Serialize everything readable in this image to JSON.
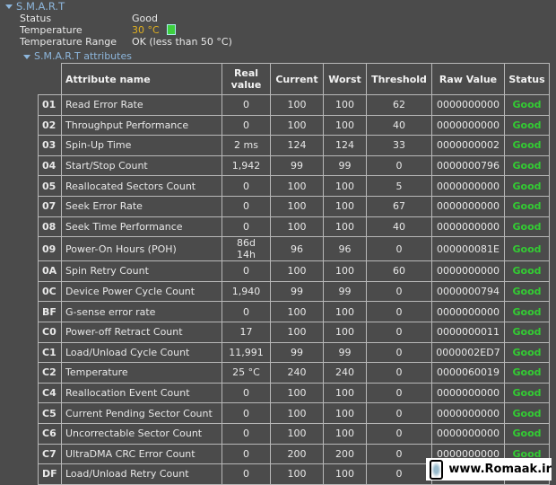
{
  "section": "S.M.A.R.T",
  "info": [
    {
      "label": "Status",
      "value": "Good"
    },
    {
      "label": "Temperature",
      "value": "30 °C"
    },
    {
      "label": "Temperature Range",
      "value": "OK (less than 50 °C)"
    }
  ],
  "subsection": "S.M.A.R.T attributes",
  "colors": {
    "temperature": "#e0b020",
    "good": "#33cc33",
    "section": "#8db6dc"
  },
  "headers": [
    "Attribute name",
    "Real value",
    "Current",
    "Worst",
    "Threshold",
    "Raw Value",
    "Status"
  ],
  "rows": [
    [
      "01",
      "Read Error Rate",
      "0",
      "100",
      "100",
      "62",
      "0000000000",
      "Good"
    ],
    [
      "02",
      "Throughput Performance",
      "0",
      "100",
      "100",
      "40",
      "0000000000",
      "Good"
    ],
    [
      "03",
      "Spin-Up Time",
      "2 ms",
      "124",
      "124",
      "33",
      "0000000002",
      "Good"
    ],
    [
      "04",
      "Start/Stop Count",
      "1,942",
      "99",
      "99",
      "0",
      "0000000796",
      "Good"
    ],
    [
      "05",
      "Reallocated Sectors Count",
      "0",
      "100",
      "100",
      "5",
      "0000000000",
      "Good"
    ],
    [
      "07",
      "Seek Error Rate",
      "0",
      "100",
      "100",
      "67",
      "0000000000",
      "Good"
    ],
    [
      "08",
      "Seek Time Performance",
      "0",
      "100",
      "100",
      "40",
      "0000000000",
      "Good"
    ],
    [
      "09",
      "Power-On Hours (POH)",
      "86d 14h",
      "96",
      "96",
      "0",
      "000000081E",
      "Good"
    ],
    [
      "0A",
      "Spin Retry Count",
      "0",
      "100",
      "100",
      "60",
      "0000000000",
      "Good"
    ],
    [
      "0C",
      "Device Power Cycle Count",
      "1,940",
      "99",
      "99",
      "0",
      "0000000794",
      "Good"
    ],
    [
      "BF",
      "G-sense error rate",
      "0",
      "100",
      "100",
      "0",
      "0000000000",
      "Good"
    ],
    [
      "C0",
      "Power-off Retract Count",
      "17",
      "100",
      "100",
      "0",
      "0000000011",
      "Good"
    ],
    [
      "C1",
      "Load/Unload Cycle Count",
      "11,991",
      "99",
      "99",
      "0",
      "0000002ED7",
      "Good"
    ],
    [
      "C2",
      "Temperature",
      "25 °C",
      "240",
      "240",
      "0",
      "0000060019",
      "Good"
    ],
    [
      "C4",
      "Reallocation Event Count",
      "0",
      "100",
      "100",
      "0",
      "0000000000",
      "Good"
    ],
    [
      "C5",
      "Current Pending Sector Count",
      "0",
      "100",
      "100",
      "0",
      "0000000000",
      "Good"
    ],
    [
      "C6",
      "Uncorrectable Sector Count",
      "0",
      "100",
      "100",
      "0",
      "0000000000",
      "Good"
    ],
    [
      "C7",
      "UltraDMA CRC Error Count",
      "0",
      "200",
      "200",
      "0",
      "0000000000",
      "Good"
    ],
    [
      "DF",
      "Load/Unload Retry Count",
      "0",
      "100",
      "100",
      "0",
      "0000000000",
      "Good"
    ]
  ],
  "watermark": "www.Romaak.ir"
}
